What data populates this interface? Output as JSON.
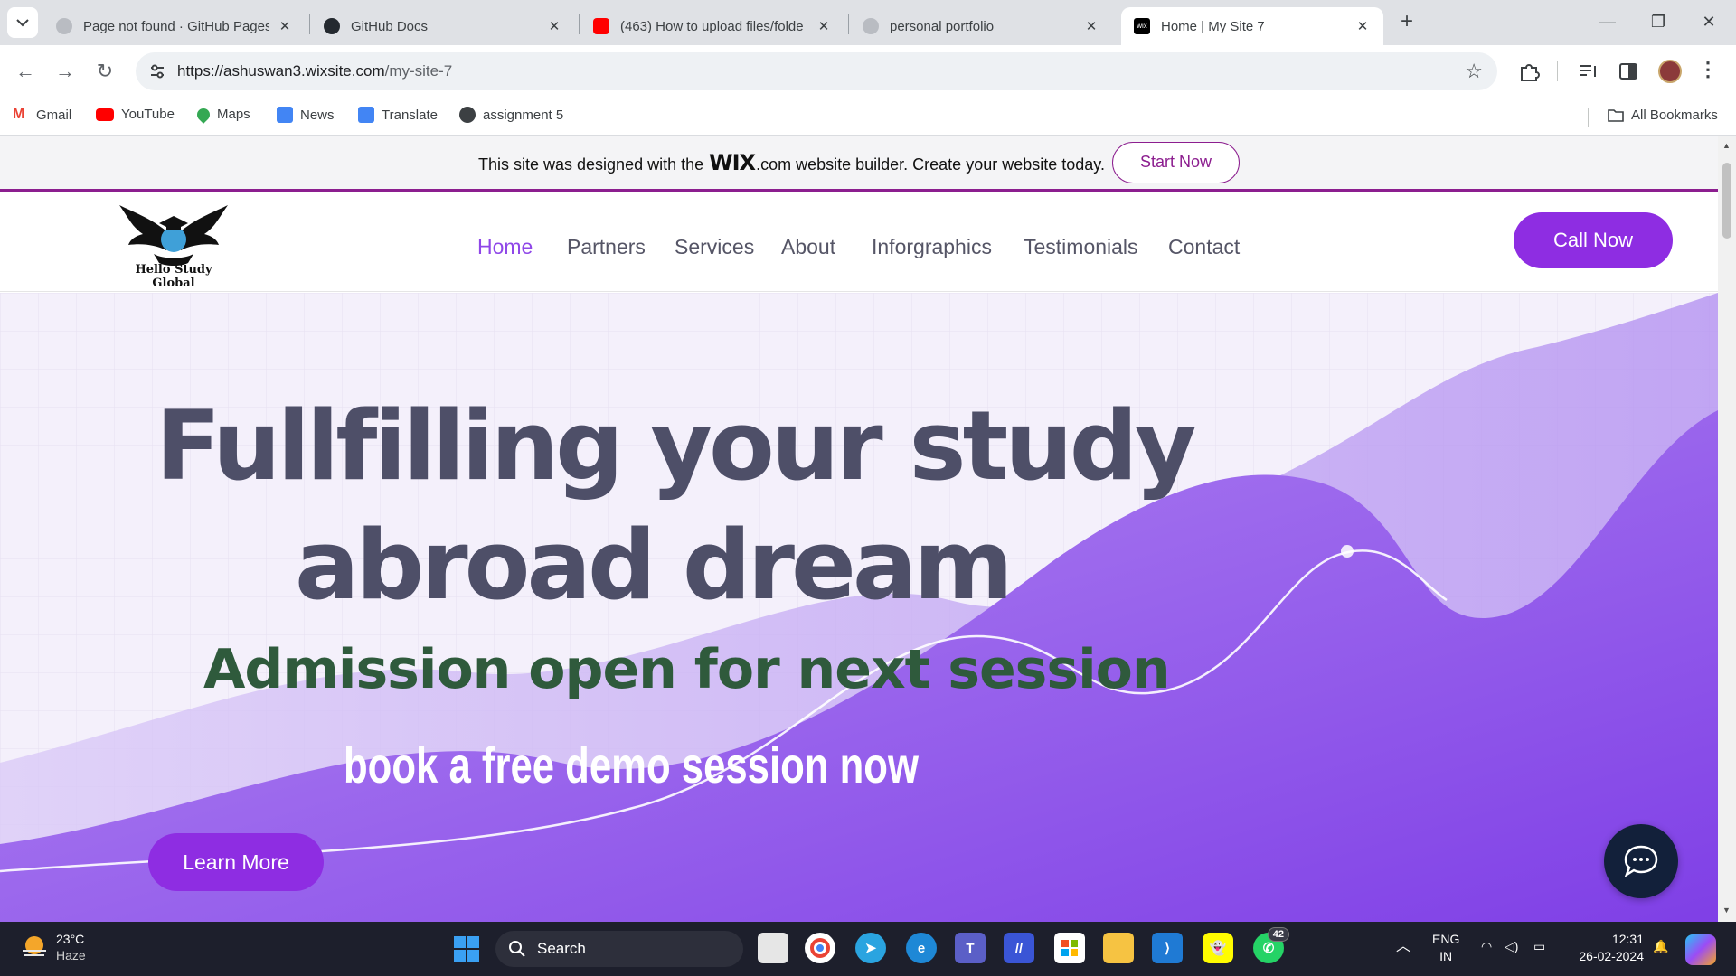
{
  "tabs": [
    {
      "title": "Page not found · GitHub Pages",
      "active": false
    },
    {
      "title": "GitHub Docs",
      "active": false
    },
    {
      "title": "(463) How to upload files/folde",
      "active": false
    },
    {
      "title": "personal portfolio",
      "active": false
    },
    {
      "title": "Home | My Site 7",
      "active": true
    }
  ],
  "address_bar": {
    "host": "https://ashuswan3.wixsite.com",
    "path": "/my-site-7"
  },
  "bookmarks": {
    "items": [
      "Gmail",
      "YouTube",
      "Maps",
      "News",
      "Translate",
      "assignment 5"
    ],
    "all_bookmarks": "All Bookmarks"
  },
  "wix_banner": {
    "text_before": "This site was designed with the",
    "logo_mark": "WIX",
    "logo_suffix": ".com",
    "text_after": "website builder. Create your website today.",
    "cta": "Start Now"
  },
  "site": {
    "logo_text": "Hello Study Global",
    "nav": [
      "Home",
      "Partners",
      "Services",
      "About",
      "Inforgraphics",
      "Testimonials",
      "Contact"
    ],
    "active_nav": "Home",
    "call_button": "Call Now"
  },
  "hero": {
    "headline_line1": "Fullfilling your study",
    "headline_line2": "abroad dream",
    "subline": "Admission open for next session",
    "demo_text": "book a free demo session  now",
    "learn_more": "Learn More"
  },
  "taskbar": {
    "weather_temp": "23°C",
    "weather_condition": "Haze",
    "search_placeholder": "Search",
    "whatsapp_badge": "42",
    "lang_line1": "ENG",
    "lang_line2": "IN",
    "time": "12:31",
    "date": "26-02-2024"
  },
  "colors": {
    "brand_purple": "#8e2de2",
    "wix_accent": "#8c1e8f",
    "headline_gray": "#4e4f68",
    "subline_green": "#2f5a3c"
  }
}
